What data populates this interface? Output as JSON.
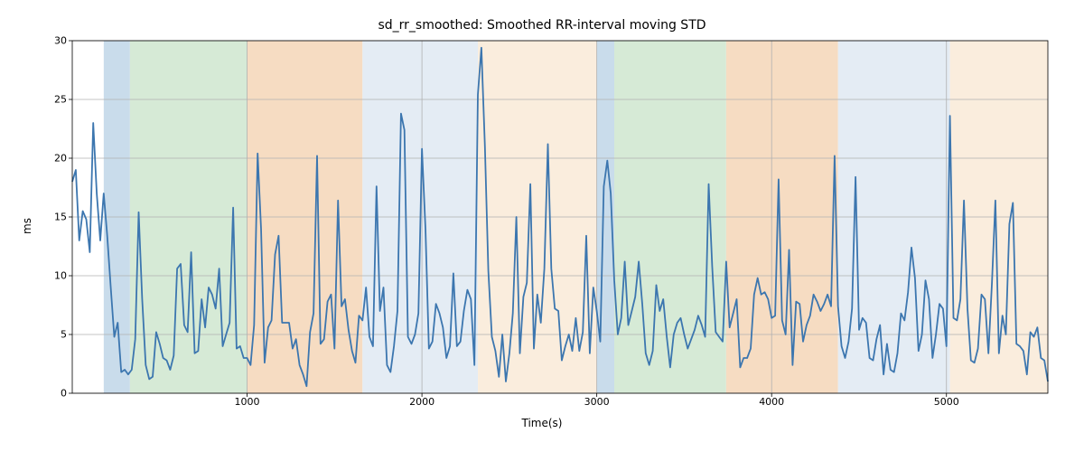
{
  "chart_data": {
    "type": "line",
    "title": "sd_rr_smoothed: Smoothed RR-interval moving STD",
    "xlabel": "Time(s)",
    "ylabel": "ms",
    "xlim": [
      0,
      5580
    ],
    "ylim": [
      0,
      30
    ],
    "xticks": [
      1000,
      2000,
      3000,
      4000,
      5000
    ],
    "yticks": [
      0,
      5,
      10,
      15,
      20,
      25,
      30
    ],
    "regions": [
      {
        "x0": 180,
        "x1": 330,
        "color": "#c9dceb"
      },
      {
        "x0": 330,
        "x1": 1000,
        "color": "#d6ead6"
      },
      {
        "x0": 1000,
        "x1": 1660,
        "color": "#f6dcc2"
      },
      {
        "x0": 1660,
        "x1": 2320,
        "color": "#e4ecf4"
      },
      {
        "x0": 2320,
        "x1": 3000,
        "color": "#faeddd"
      },
      {
        "x0": 3000,
        "x1": 3100,
        "color": "#c9dceb"
      },
      {
        "x0": 3100,
        "x1": 3740,
        "color": "#d6ead6"
      },
      {
        "x0": 3740,
        "x1": 4380,
        "color": "#f6dcc2"
      },
      {
        "x0": 4380,
        "x1": 5020,
        "color": "#e4ecf4"
      },
      {
        "x0": 5020,
        "x1": 5580,
        "color": "#faeddd"
      }
    ],
    "series": [
      {
        "name": "sd_rr",
        "color": "#3c76af",
        "x_interval": 20,
        "values": [
          18.0,
          19.0,
          13.0,
          15.5,
          14.8,
          12.0,
          23.0,
          17.0,
          13.0,
          17.0,
          13.4,
          9.0,
          4.8,
          6.0,
          1.8,
          2.0,
          1.6,
          2.0,
          4.6,
          15.4,
          8.0,
          2.4,
          1.2,
          1.4,
          5.2,
          4.2,
          3.0,
          2.8,
          2.0,
          3.2,
          10.6,
          11.0,
          5.8,
          5.2,
          12.0,
          3.4,
          3.6,
          8.0,
          5.6,
          9.0,
          8.4,
          7.2,
          10.6,
          4.0,
          5.0,
          6.0,
          15.8,
          3.8,
          4.0,
          3.0,
          3.0,
          2.4,
          5.8,
          20.4,
          14.0,
          2.6,
          5.6,
          6.2,
          11.8,
          13.4,
          6.0,
          6.0,
          6.0,
          3.8,
          4.6,
          2.4,
          1.6,
          0.6,
          5.2,
          6.8,
          20.2,
          4.2,
          4.6,
          7.8,
          8.4,
          3.8,
          16.4,
          7.4,
          8.0,
          5.4,
          3.6,
          2.6,
          6.6,
          6.2,
          9.0,
          4.8,
          4.0,
          17.6,
          7.0,
          9.0,
          2.4,
          1.8,
          4.0,
          7.0,
          23.8,
          22.4,
          4.8,
          4.2,
          5.0,
          6.8,
          20.8,
          14.0,
          3.8,
          4.4,
          7.6,
          6.8,
          5.6,
          3.0,
          4.0,
          10.2,
          4.0,
          4.4,
          7.0,
          8.8,
          8.0,
          2.4,
          25.4,
          29.4,
          21.0,
          10.4,
          4.8,
          3.6,
          1.4,
          5.0,
          1.0,
          3.4,
          6.8,
          15.0,
          3.4,
          8.2,
          9.4,
          17.8,
          3.8,
          8.4,
          6.0,
          10.6,
          21.2,
          10.6,
          7.2,
          7.0,
          2.8,
          4.0,
          5.0,
          3.6,
          6.4,
          3.6,
          5.2,
          13.4,
          3.4,
          9.0,
          7.0,
          4.4,
          17.6,
          19.8,
          17.0,
          9.6,
          5.0,
          6.4,
          11.2,
          5.8,
          7.0,
          8.2,
          11.2,
          7.6,
          3.4,
          2.4,
          3.6,
          9.2,
          7.0,
          8.0,
          4.8,
          2.2,
          5.0,
          6.0,
          6.4,
          5.0,
          3.8,
          4.6,
          5.4,
          6.6,
          5.8,
          4.8,
          17.8,
          10.8,
          5.2,
          4.8,
          4.4,
          11.2,
          5.6,
          6.8,
          8.0,
          2.2,
          3.0,
          3.0,
          3.8,
          8.4,
          9.8,
          8.4,
          8.6,
          8.0,
          6.4,
          6.6,
          18.2,
          6.2,
          5.0,
          12.2,
          2.4,
          7.8,
          7.6,
          4.4,
          5.8,
          6.6,
          8.4,
          7.8,
          7.0,
          7.6,
          8.4,
          7.4,
          20.2,
          7.4,
          4.0,
          3.0,
          4.4,
          7.2,
          18.4,
          5.4,
          6.4,
          6.0,
          3.0,
          2.8,
          4.6,
          5.8,
          1.6,
          4.2,
          2.0,
          1.8,
          3.4,
          6.8,
          6.2,
          8.6,
          12.4,
          9.8,
          3.6,
          5.0,
          9.6,
          8.0,
          3.0,
          5.0,
          7.6,
          7.2,
          4.0,
          23.6,
          6.4,
          6.2,
          8.0,
          16.4,
          7.2,
          2.8,
          2.6,
          3.8,
          8.4,
          8.0,
          3.4,
          9.4,
          16.4,
          3.4,
          6.6,
          5.0,
          14.4,
          16.2,
          4.2,
          4.0,
          3.6,
          1.6,
          5.2,
          4.8,
          5.6,
          3.0,
          2.8,
          1.0
        ]
      }
    ]
  }
}
